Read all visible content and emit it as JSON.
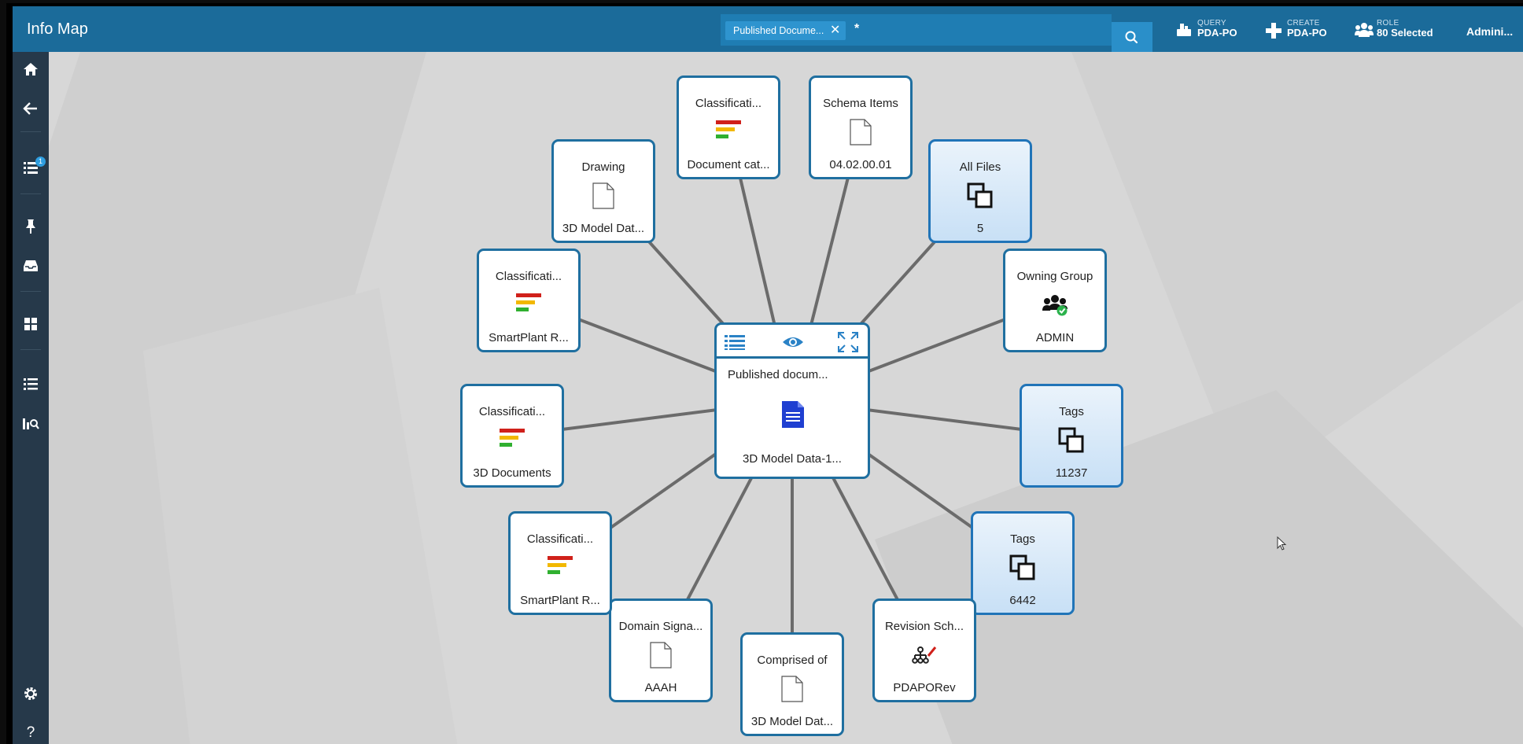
{
  "header": {
    "title": "Info Map",
    "search_chip": "Published Docume...",
    "search_query": "*",
    "query": {
      "caption": "QUERY",
      "value": "PDA-PO"
    },
    "create": {
      "caption": "CREATE",
      "value": "PDA-PO"
    },
    "role": {
      "caption": "ROLE",
      "value": "80 Selected"
    },
    "user": "Admini..."
  },
  "sidebar": {
    "list_badge": "1",
    "items": [
      "home-icon",
      "back-arrow-icon",
      "list-icon",
      "pin-icon",
      "inbox-icon",
      "dashboard-icon",
      "ordered-list-icon",
      "report-icon",
      "gear-icon",
      "help-icon"
    ]
  },
  "center": {
    "title": "Published docum...",
    "name": "3D Model Data-1..."
  },
  "nodes": [
    {
      "top": "Classificati...",
      "bottom": "Document cat...",
      "icon": "classification-icon"
    },
    {
      "top": "Schema Items",
      "bottom": "04.02.00.01",
      "icon": "document-icon"
    },
    {
      "top": "All Files",
      "bottom": "5",
      "icon": "collection-icon"
    },
    {
      "top": "Owning Group",
      "bottom": "ADMIN",
      "icon": "group-icon"
    },
    {
      "top": "Tags",
      "bottom": "11237",
      "icon": "collection-icon"
    },
    {
      "top": "Tags",
      "bottom": "6442",
      "icon": "collection-icon"
    },
    {
      "top": "Revision Sch...",
      "bottom": "PDAPORev",
      "icon": "revision-scheme-icon"
    },
    {
      "top": "Comprised of",
      "bottom": "3D Model Dat...",
      "icon": "document-icon"
    },
    {
      "top": "Domain Signa...",
      "bottom": "AAAH",
      "icon": "document-icon"
    },
    {
      "top": "Classificati...",
      "bottom": "SmartPlant R...",
      "icon": "classification-icon"
    },
    {
      "top": "Classificati...",
      "bottom": "3D Documents",
      "icon": "classification-icon"
    },
    {
      "top": "Classificati...",
      "bottom": "SmartPlant R...",
      "icon": "classification-icon"
    },
    {
      "top": "Drawing",
      "bottom": "3D Model Dat...",
      "icon": "document-icon"
    }
  ],
  "colors": {
    "header": "#1b6b9a",
    "sidebar": "#26394a",
    "node_border": "#1f6fa0",
    "selected_node": "#c8e0f6",
    "edge": "#6b6b6b"
  }
}
